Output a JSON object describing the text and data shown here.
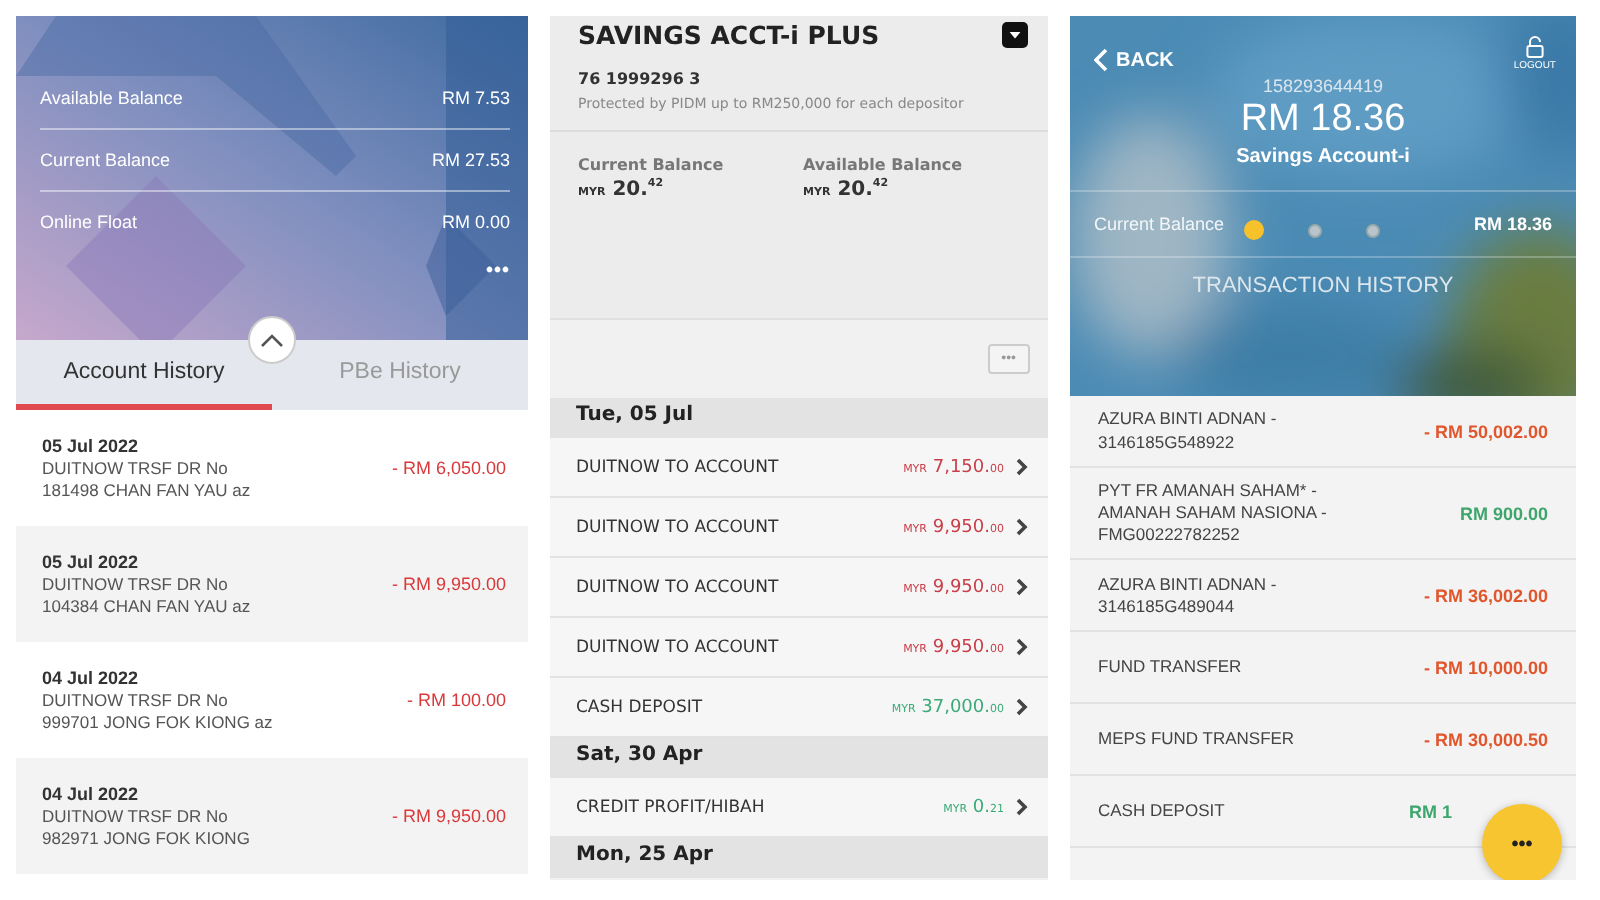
{
  "panel_1": {
    "balances": [
      {
        "label": "Available Balance",
        "value": "RM 7.53"
      },
      {
        "label": "Current Balance",
        "value": "RM 27.53"
      },
      {
        "label": "Online Float",
        "value": "RM 0.00"
      }
    ],
    "more_label": "•••",
    "tabs": [
      {
        "label": "Account History",
        "selected": true
      },
      {
        "label": "PBe History",
        "selected": false
      }
    ],
    "transactions": [
      {
        "date": "05 Jul 2022",
        "description": "DUITNOW TRSF DR No 181498 CHAN FAN YAU az",
        "amount": "- RM 6,050.00"
      },
      {
        "date": "05 Jul 2022",
        "description": "DUITNOW TRSF DR No 104384 CHAN FAN YAU az",
        "amount": "- RM 9,950.00"
      },
      {
        "date": "04 Jul 2022",
        "description": "DUITNOW TRSF DR No 999701 JONG FOK KIONG az",
        "amount": "- RM 100.00"
      },
      {
        "date": "04 Jul 2022",
        "description": "DUITNOW TRSF DR No 982971 JONG FOK KIONG",
        "amount": "- RM 9,950.00"
      }
    ]
  },
  "panel_2": {
    "title": "SAVINGS ACCT-i PLUS",
    "account_number": "76 1999296 3",
    "note": "Protected by PIDM up to RM250,000 for each depositor",
    "balances": [
      {
        "label": "Current Balance",
        "currency": "MYR",
        "value": "20.$^{42}$"
      },
      {
        "label": "Available Balance",
        "currency": "MYR",
        "value": "20.$^{42}$"
      }
    ],
    "more_label": "•••",
    "groups": [
      {
        "date": "Tue, 05 Jul",
        "rows": [
          {
            "description": "DUITNOW TO ACCOUNT",
            "currency": "MYR",
            "whole": "7,150.",
            "cents": "00",
            "kind": "debit"
          },
          {
            "description": "DUITNOW TO ACCOUNT",
            "currency": "MYR",
            "whole": "9,950.",
            "cents": "00",
            "kind": "debit"
          },
          {
            "description": "DUITNOW TO ACCOUNT",
            "currency": "MYR",
            "whole": "9,950.",
            "cents": "00",
            "kind": "debit"
          },
          {
            "description": "DUITNOW TO ACCOUNT",
            "currency": "MYR",
            "whole": "9,950.",
            "cents": "00",
            "kind": "debit"
          },
          {
            "description": "CASH DEPOSIT",
            "currency": "MYR",
            "whole": "37,000.",
            "cents": "00",
            "kind": "credit"
          }
        ]
      },
      {
        "date": "Sat, 30 Apr",
        "rows": [
          {
            "description": "CREDIT PROFIT/HIBAH",
            "currency": "MYR",
            "whole": "0.",
            "cents": "21",
            "kind": "credit"
          }
        ]
      },
      {
        "date": "Mon, 25 Apr"
      }
    ]
  },
  "panel_3": {
    "back_label": "BACK",
    "logout_label": "LOGOUT",
    "account_number": "158293644419",
    "amount": "RM 18.36",
    "account_name": "Savings Account-i",
    "balance_label": "Current Balance",
    "balance_value": "RM 18.36",
    "pages": [
      {
        "selected": true
      },
      {
        "selected": false
      },
      {
        "selected": false
      }
    ],
    "section_title": "TRANSACTION HISTORY",
    "transactions": [
      {
        "description": "AZURA BINTI ADNAN - 3146185G548922",
        "amount": "- RM 50,002.00",
        "kind": "debit"
      },
      {
        "description": "PYT FR AMANAH SAHAM* - AMANAH SAHAM NASIONA - FMG00222782252",
        "amount": "RM 900.00",
        "kind": "credit"
      },
      {
        "description": "AZURA BINTI ADNAN - 3146185G489044",
        "amount": "- RM 36,002.00",
        "kind": "debit"
      },
      {
        "description": "FUND TRANSFER",
        "amount": "- RM 10,000.00",
        "kind": "debit"
      },
      {
        "description": "MEPS FUND TRANSFER",
        "amount": "- RM 30,000.50",
        "kind": "debit"
      },
      {
        "description": "CASH DEPOSIT",
        "amount": "RM 1",
        "kind": "credit"
      }
    ],
    "fab_label": "•••"
  }
}
